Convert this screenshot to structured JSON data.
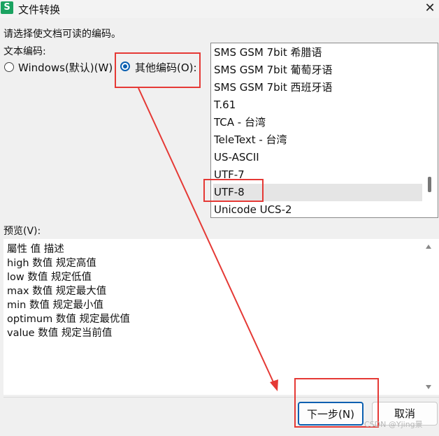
{
  "window": {
    "title": "文件转换",
    "app_icon": "S"
  },
  "prompt": "请选择使文档可读的编码。",
  "encoding_section": {
    "label": "文本编码:",
    "windows_option": "Windows(默认)(W)",
    "other_option": "其他编码(O):",
    "selected": "other"
  },
  "encoding_list": {
    "items": [
      "SMS GSM 7bit 希腊语",
      "SMS GSM 7bit 葡萄牙语",
      "SMS GSM 7bit 西班牙语",
      "T.61",
      "TCA - 台湾",
      "TeleText - 台湾",
      "US-ASCII",
      "UTF-7",
      "UTF-8",
      "Unicode UCS-2"
    ],
    "selected": "UTF-8"
  },
  "preview": {
    "label": "预览(V):",
    "lines": [
      "屬性 值 描述",
      "high 数值 规定高值",
      "low 数值 规定低值",
      "max 数值 规定最大值",
      "min 数值 规定最小值",
      "optimum 数值 规定最优值",
      "value 数值 规定当前值"
    ]
  },
  "buttons": {
    "next": "下一步(N)",
    "cancel": "取消"
  },
  "watermark": "CSDN @Yjing景",
  "annotation_color": "#e53935"
}
